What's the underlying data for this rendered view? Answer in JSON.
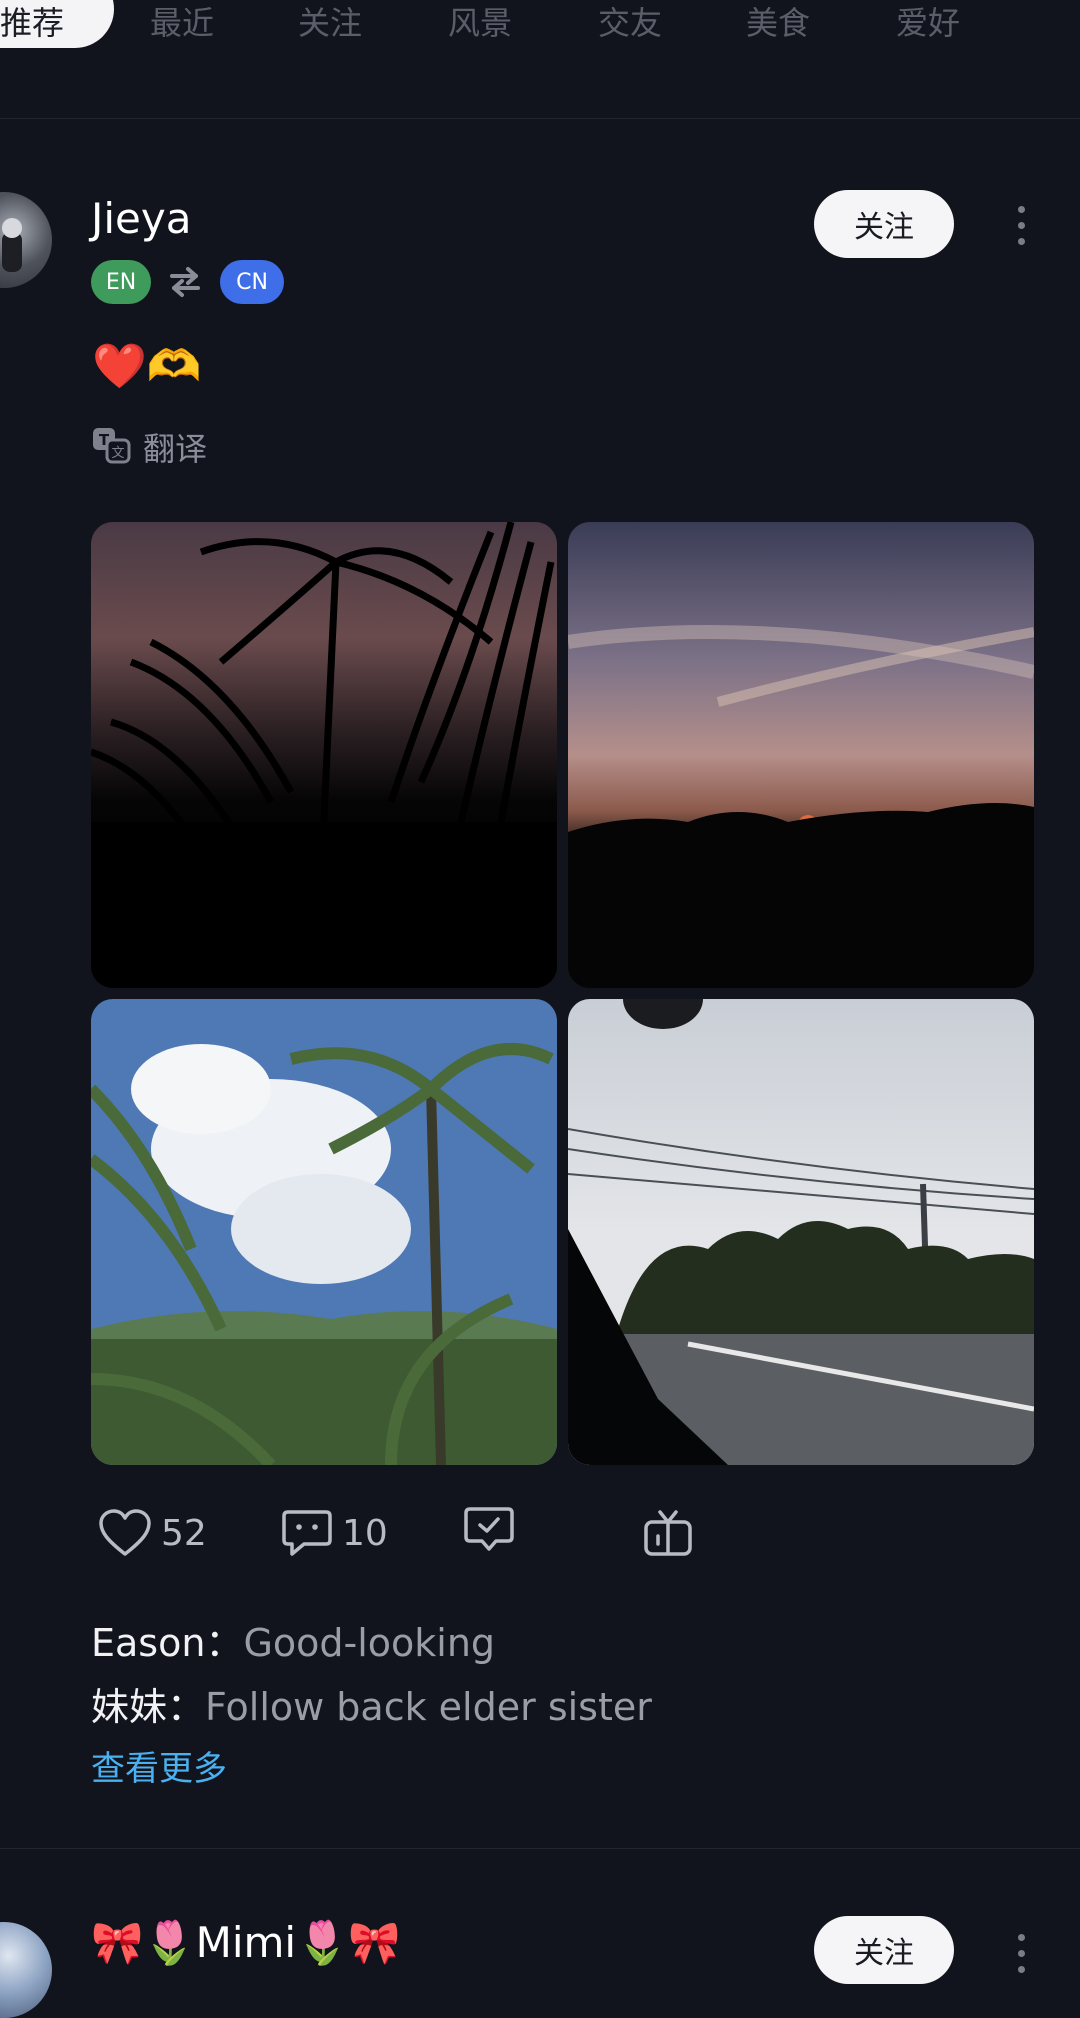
{
  "tabs": [
    "推荐",
    "最近",
    "关注",
    "风景",
    "交友",
    "美食",
    "爱好"
  ],
  "post": {
    "username": "Jieya",
    "lang_from": "EN",
    "lang_to": "CN",
    "follow_label": "关注",
    "content": "❤️🫶",
    "translate_label": "翻译",
    "likes": "52",
    "comments_count": "10",
    "comments": [
      {
        "author": "Eason：",
        "text": "Good-looking"
      },
      {
        "author": "妹妹：",
        "text": "Follow back elder sister"
      }
    ],
    "see_more": "查看更多"
  },
  "next_post": {
    "username": "🎀🌷Mimi🌷🎀",
    "follow_label": "关注"
  },
  "colors": {
    "background": "#12141d",
    "lang_en": "#3f9b5c",
    "lang_cn": "#3f6fe8",
    "link": "#4ab0f0"
  }
}
